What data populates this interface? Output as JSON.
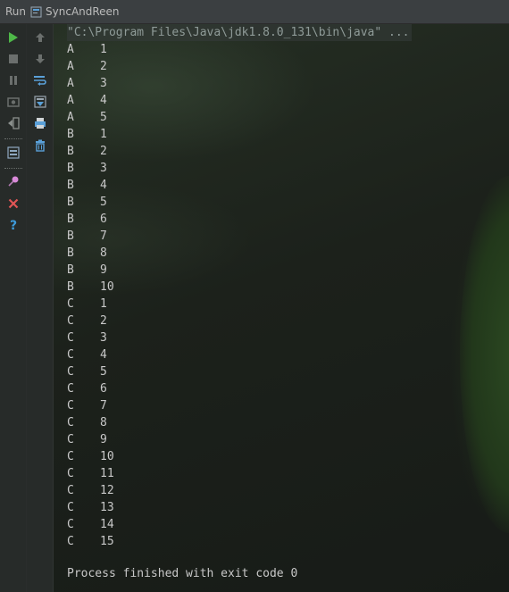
{
  "titlebar": {
    "run_label": "Run",
    "config_name": "SyncAndReen"
  },
  "toolbar_left": [
    {
      "name": "rerun-icon",
      "color": "#4eb848"
    },
    {
      "name": "stop-icon",
      "color": "#6b6f6d"
    },
    {
      "name": "pause-icon",
      "color": "#6b6f6d"
    },
    {
      "name": "dump-threads-icon",
      "color": "#6b6f6d"
    },
    {
      "name": "exit-icon",
      "color": "#8a8f8c"
    },
    {
      "name": "restore-layout-icon",
      "color": "#8fa8c0"
    },
    {
      "name": "pin-icon",
      "color": "#d98ad9"
    },
    {
      "name": "close-icon",
      "color": "#e05555"
    },
    {
      "name": "help-icon",
      "color": "#3d9ad9"
    }
  ],
  "toolbar_right": [
    {
      "name": "up-arrow-icon",
      "color": "#6b6f6d"
    },
    {
      "name": "down-arrow-icon",
      "color": "#6b6f6d"
    },
    {
      "name": "soft-wrap-icon",
      "color": "#5aa0d8"
    },
    {
      "name": "scroll-to-end-icon",
      "color": "#9aa6b0"
    },
    {
      "name": "print-icon",
      "color": "#5aa0d8"
    },
    {
      "name": "clear-all-icon",
      "color": "#5aa0d8"
    }
  ],
  "console": {
    "command": "\"C:\\Program Files\\Java\\jdk1.8.0_131\\bin\\java\" ...",
    "lines": [
      {
        "letter": "A",
        "num": "1"
      },
      {
        "letter": "A",
        "num": "2"
      },
      {
        "letter": "A",
        "num": "3"
      },
      {
        "letter": "A",
        "num": "4"
      },
      {
        "letter": "A",
        "num": "5"
      },
      {
        "letter": "B",
        "num": "1"
      },
      {
        "letter": "B",
        "num": "2"
      },
      {
        "letter": "B",
        "num": "3"
      },
      {
        "letter": "B",
        "num": "4"
      },
      {
        "letter": "B",
        "num": "5"
      },
      {
        "letter": "B",
        "num": "6"
      },
      {
        "letter": "B",
        "num": "7"
      },
      {
        "letter": "B",
        "num": "8"
      },
      {
        "letter": "B",
        "num": "9"
      },
      {
        "letter": "B",
        "num": "10"
      },
      {
        "letter": "C",
        "num": "1"
      },
      {
        "letter": "C",
        "num": "2"
      },
      {
        "letter": "C",
        "num": "3"
      },
      {
        "letter": "C",
        "num": "4"
      },
      {
        "letter": "C",
        "num": "5"
      },
      {
        "letter": "C",
        "num": "6"
      },
      {
        "letter": "C",
        "num": "7"
      },
      {
        "letter": "C",
        "num": "8"
      },
      {
        "letter": "C",
        "num": "9"
      },
      {
        "letter": "C",
        "num": "10"
      },
      {
        "letter": "C",
        "num": "11"
      },
      {
        "letter": "C",
        "num": "12"
      },
      {
        "letter": "C",
        "num": "13"
      },
      {
        "letter": "C",
        "num": "14"
      },
      {
        "letter": "C",
        "num": "15"
      }
    ],
    "footer": "Process finished with exit code 0"
  }
}
